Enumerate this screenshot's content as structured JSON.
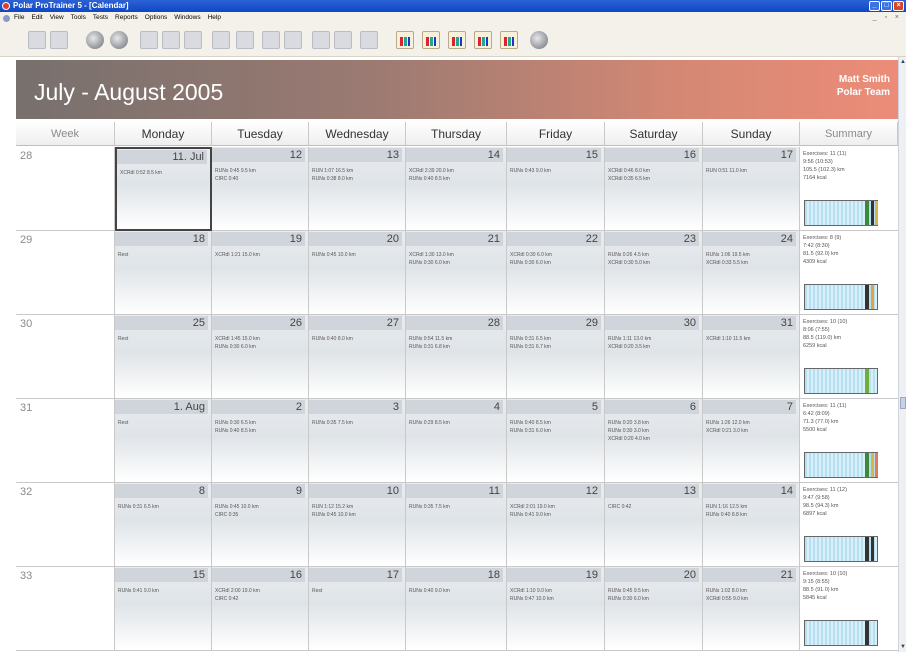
{
  "window": {
    "title": "Polar ProTrainer 5 - [Calendar]"
  },
  "menu": [
    "File",
    "Edit",
    "View",
    "Tools",
    "Tests",
    "Reports",
    "Options",
    "Windows",
    "Help"
  ],
  "toolbar_icons": [
    "open-folder-icon",
    "save-icon",
    "person-icon",
    "person-swap-icon",
    "calendar-icon",
    "notebook-icon",
    "pen-icon",
    "list-icon",
    "chart-gray-icon",
    "table-gray-icon",
    "columns-gray-icon",
    "search-gray-icon",
    "download-gray-icon",
    "upload-gray-icon",
    "bar-chart-icon",
    "bar-chart-red-icon",
    "bar-chart-blue-icon",
    "bar-chart-multi-icon",
    "bar-chart-orange-icon",
    "people-icon"
  ],
  "header": {
    "title": "July - August 2005",
    "user": "Matt Smith",
    "team": "Polar Team"
  },
  "columns": [
    "Week",
    "Monday",
    "Tuesday",
    "Wednesday",
    "Thursday",
    "Friday",
    "Saturday",
    "Sunday",
    "Summary"
  ],
  "weeks": [
    {
      "week": "28",
      "days": [
        {
          "date": "11. Jul",
          "selected": true,
          "exercises": [
            "XCRdl 0:52 8.5 km"
          ]
        },
        {
          "date": "12",
          "exercises": [
            "RUNs 0:45 9.5 km",
            "CIRC 0:40"
          ]
        },
        {
          "date": "13",
          "exercises": [
            "RUN 1:07 16.5 km",
            "RUNs 0:38 8.0 km"
          ]
        },
        {
          "date": "14",
          "exercises": [
            "XCRdl 2:39 20.0 km",
            "RUNs 0:40 8.5 km"
          ]
        },
        {
          "date": "15",
          "exercises": [
            "RUNs 0:43 9.0 km"
          ]
        },
        {
          "date": "16",
          "exercises": [
            "XCRdl 0:46 8.0 km",
            "XCRdl 0:35 6.5 km"
          ]
        },
        {
          "date": "17",
          "exercises": [
            "RUN 0:51 11.0 km"
          ]
        }
      ],
      "summary": [
        "Exercises: 11 (11)",
        "9:56 (10:53)",
        "105.5  (102.3) km",
        "7164 kcal"
      ],
      "marks": [
        "#3a8a3a",
        "#333333",
        "#d9b44a"
      ]
    },
    {
      "week": "29",
      "days": [
        {
          "date": "18",
          "exercises": [
            "Rest"
          ]
        },
        {
          "date": "19",
          "exercises": [
            "XCRdl 1:21 15.0 km"
          ]
        },
        {
          "date": "20",
          "exercises": [
            "RUNs 0:45 10.0 km"
          ]
        },
        {
          "date": "21",
          "exercises": [
            "XCRdl 1:30 13.0 km",
            "RUNs 0:30 6.0 km"
          ]
        },
        {
          "date": "22",
          "exercises": [
            "XCRdl 0:30 6.0 km",
            "RUNs 0:30 6.0 km"
          ]
        },
        {
          "date": "23",
          "exercises": [
            "RUNs 0:26 4.5 km",
            "XCRdl 0:30 5.0 km"
          ]
        },
        {
          "date": "24",
          "exercises": [
            "RUNs 1:06 19.5 km",
            "XCRdl 0:33 5.5 km"
          ]
        }
      ],
      "summary": [
        "Exercises: 8 (9)",
        "7:42 (8:30)",
        "81.5  (92.0) km",
        "4309 kcal"
      ],
      "marks": [
        "#333333",
        "#e0a63a"
      ]
    },
    {
      "week": "30",
      "days": [
        {
          "date": "25",
          "exercises": [
            "Rest"
          ]
        },
        {
          "date": "26",
          "exercises": [
            "XCRdl 1:45 15.0 km",
            "RUNs 0:30 6.0 km"
          ]
        },
        {
          "date": "27",
          "exercises": [
            "RUNs 0:40 8.0 km"
          ]
        },
        {
          "date": "28",
          "exercises": [
            "RUNs 0:54 11.5 km",
            "RUNs 0:31 6.8 km"
          ]
        },
        {
          "date": "29",
          "exercises": [
            "RUNs 0:31 6.5 km",
            "RUNs 0:31 6.7 km"
          ]
        },
        {
          "date": "30",
          "exercises": [
            "RUNs 1:11 13.0 km",
            "XCRdl 0:20 3.5 km"
          ]
        },
        {
          "date": "31",
          "exercises": [
            "XCRdl 1:10 11.5 km"
          ]
        }
      ],
      "summary": [
        "Exercises: 10 (10)",
        "8:06 (7:55)",
        "88.5  (119.0) km",
        "6259 kcal"
      ],
      "marks": [
        "#6fae3a"
      ]
    },
    {
      "week": "31",
      "days": [
        {
          "date": "1. Aug",
          "exercises": [
            "Rest"
          ]
        },
        {
          "date": "2",
          "exercises": [
            "RUNs 0:30 6.5 km",
            "RUNs 0:40 8.5 km"
          ]
        },
        {
          "date": "3",
          "exercises": [
            "RUNs 0:35 7.5 km"
          ]
        },
        {
          "date": "4",
          "exercises": [
            "RUNs 0:29 8.5 km"
          ]
        },
        {
          "date": "5",
          "exercises": [
            "RUNs 0:40 8.5 km",
            "RUNs 0:31 6.0 km"
          ]
        },
        {
          "date": "6",
          "exercises": [
            "RUNs 0:20 3.8 km",
            "RUNs 0:30 3.0 km",
            "XCRdl 0:20 4.0 km"
          ]
        },
        {
          "date": "7",
          "exercises": [
            "RUNs 1:26 12.0 km",
            "XCRdl 0:21 3.0 km"
          ]
        }
      ],
      "summary": [
        "Exercises: 11 (11)",
        "6:42 (8:09)",
        "71.3  (77.0) km",
        "5500 kcal"
      ],
      "marks": [
        "#3a8a3a",
        "#d9b44a",
        "#e07a5a"
      ]
    },
    {
      "week": "32",
      "days": [
        {
          "date": "8",
          "exercises": [
            "RUNs 0:31 6.5 km"
          ]
        },
        {
          "date": "9",
          "exercises": [
            "RUNs 0:45 10.0 km",
            "CIRC 0:35"
          ]
        },
        {
          "date": "10",
          "exercises": [
            "RUN 1:12 15.2 km",
            "RUNs 0:45 10.0 km"
          ]
        },
        {
          "date": "11",
          "exercises": [
            "RUNs 0:35 7.5 km"
          ]
        },
        {
          "date": "12",
          "exercises": [
            "XCRdl 2:01 19.0 km",
            "RUNs 0:41 9.0 km"
          ]
        },
        {
          "date": "13",
          "exercises": [
            "CIRC 0:42"
          ]
        },
        {
          "date": "14",
          "exercises": [
            "RUN 1:16 12.5 km",
            "RUNs 0:40 8.8 km"
          ]
        }
      ],
      "summary": [
        "Exercises: 11 (12)",
        "9:47 (9:58)",
        "98.5  (94.3) km",
        "6897 kcal"
      ],
      "marks": [
        "#333333",
        "#333333"
      ]
    },
    {
      "week": "33",
      "days": [
        {
          "date": "15",
          "exercises": [
            "RUNs 0:41 9.0 km"
          ]
        },
        {
          "date": "16",
          "exercises": [
            "XCRdl 2:00 19.0 km",
            "CIRC 0:42"
          ]
        },
        {
          "date": "17",
          "exercises": [
            "Rest"
          ]
        },
        {
          "date": "18",
          "exercises": [
            "RUNs 0:40 9.0 km"
          ]
        },
        {
          "date": "19",
          "exercises": [
            "XCRdl 1:10 9.0 km",
            "RUNs 0:47 10.0 km"
          ]
        },
        {
          "date": "20",
          "exercises": [
            "RUNs 0:45 9.5 km",
            "RUNs 0:30 6.0 km"
          ]
        },
        {
          "date": "21",
          "exercises": [
            "RUNs 1:02 8.0 km",
            "XCRdl 0:55 9.0 km"
          ]
        }
      ],
      "summary": [
        "Exercises: 10 (10)",
        "9:15 (8:55)",
        "88.5  (91.0) km",
        "5845 kcal"
      ],
      "marks": [
        "#333333"
      ]
    }
  ]
}
